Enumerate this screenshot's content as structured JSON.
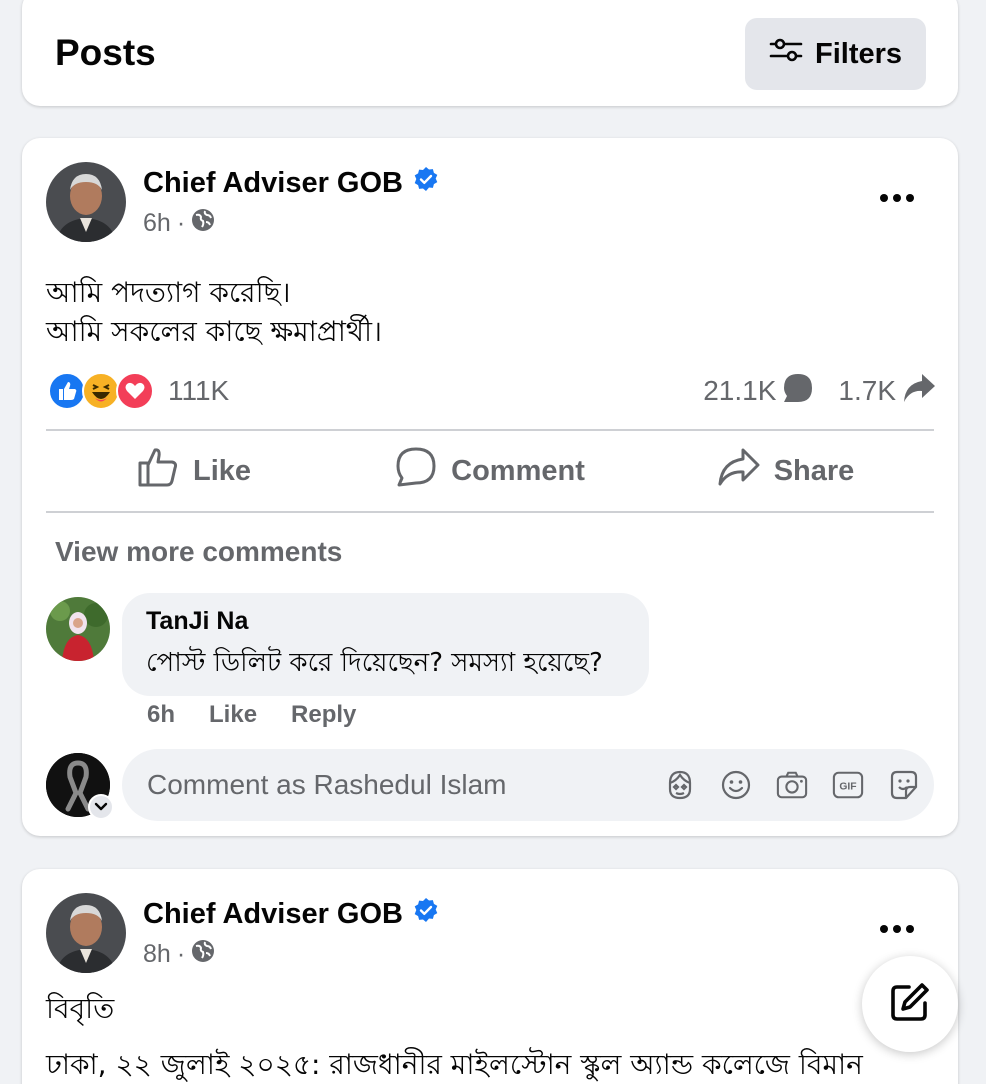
{
  "header": {
    "title": "Posts",
    "filters_label": "Filters"
  },
  "post1": {
    "author": "Chief Adviser GOB",
    "time": "6h",
    "separator": "·",
    "text_line1": "আমি পদত্যাগ করেছি।",
    "text_line2": "আমি সকলের কাছে ক্ষমাপ্রার্থী।",
    "reaction_count": "111K",
    "comments_count": "21.1K",
    "shares_count": "1.7K",
    "actions": {
      "like": "Like",
      "comment": "Comment",
      "share": "Share"
    },
    "view_more": "View more comments",
    "comment": {
      "name": "TanJi Na",
      "text": "পোস্ট ডিলিট করে দিয়েছেন? সমস্যা হয়েছে?",
      "time": "6h",
      "like": "Like",
      "reply": "Reply"
    },
    "comment_placeholder": "Comment as Rashedul Islam"
  },
  "post2": {
    "author": "Chief Adviser GOB",
    "time": "8h",
    "separator": "·",
    "heading": "বিবৃতি",
    "text": "ঢাকা, ২২ জুলাই ২০২৫: রাজধানীর মাইলস্টোন স্কুল অ্যান্ড কলেজে বিমান"
  },
  "colors": {
    "verified": "#1877f2",
    "like": "#1877f2",
    "love": "#f33e58",
    "haha": "#f7b125",
    "muted_text": "#65676b"
  }
}
